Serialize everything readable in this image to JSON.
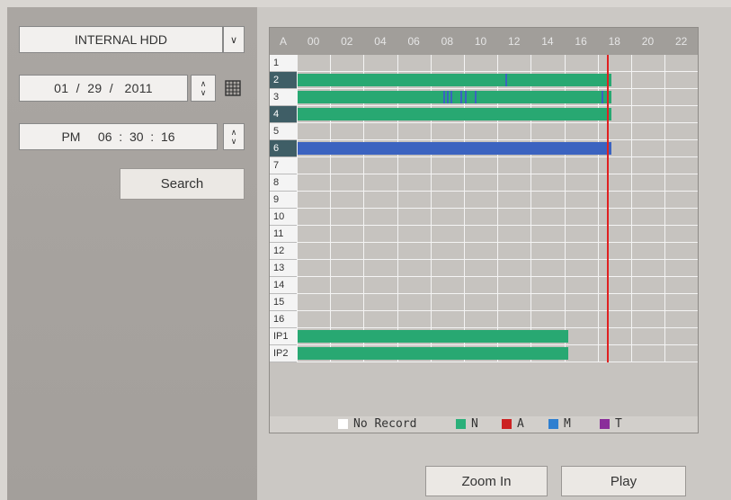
{
  "storage": {
    "selected": "INTERNAL HDD",
    "arrow": "˅"
  },
  "date": {
    "value": "01  /  29  /   2011"
  },
  "time": {
    "value": "PM     06  :  30  :  16"
  },
  "search_label": "Search",
  "grid": {
    "corner": "A",
    "hours": [
      "00",
      "02",
      "04",
      "06",
      "08",
      "10",
      "12",
      "14",
      "16",
      "18",
      "20",
      "22"
    ],
    "rows": [
      "1",
      "2",
      "3",
      "4",
      "5",
      "6",
      "7",
      "8",
      "9",
      "10",
      "11",
      "12",
      "13",
      "14",
      "15",
      "16",
      "IP1",
      "IP2"
    ],
    "selected_rows": [
      "2",
      "4",
      "6"
    ]
  },
  "legend": [
    {
      "label": "No Record",
      "color": "#ffffff"
    },
    {
      "label": "N",
      "color": "#2bb07a"
    },
    {
      "label": "A",
      "color": "#cc2222"
    },
    {
      "label": "M",
      "color": "#2f7fd0"
    },
    {
      "label": "T",
      "color": "#8a2d9a"
    }
  ],
  "colors": {
    "normal": "#28a872",
    "motion": "#3b63c0",
    "cursor": "#e02020",
    "selected_row": "#3f5e66"
  },
  "zoom_label": "Zoom In",
  "play_label": "Play"
}
